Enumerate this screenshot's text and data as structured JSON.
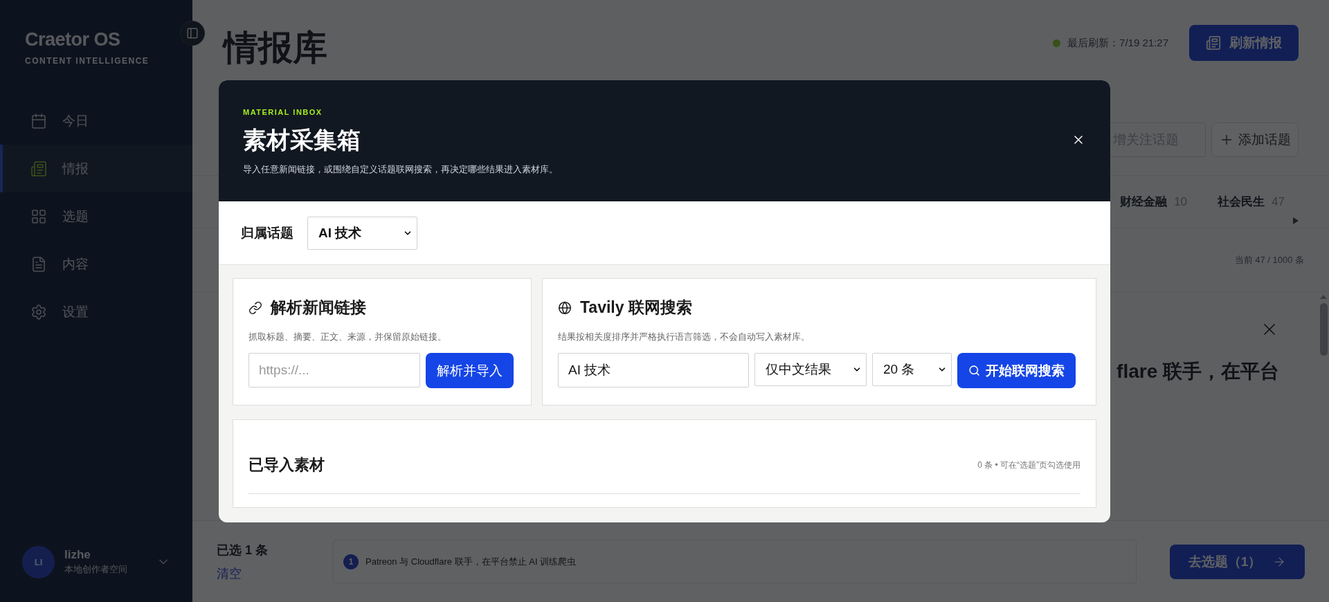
{
  "sidebar": {
    "brand": "Craetor OS",
    "brand_sub": "CONTENT INTELLIGENCE",
    "items": [
      {
        "label": "今日",
        "kind": "calendar",
        "selected": false
      },
      {
        "label": "情报",
        "kind": "news",
        "selected": true
      },
      {
        "label": "选题",
        "kind": "grid",
        "selected": false
      },
      {
        "label": "内容",
        "kind": "doc",
        "selected": false
      },
      {
        "label": "设置",
        "kind": "gear",
        "selected": false
      }
    ],
    "user": {
      "initials": "LI",
      "name": "lizhe",
      "workspace": "本地创作者空间"
    }
  },
  "header": {
    "title": "情报库",
    "refresh_label": "最后刷新：7/19 21:27",
    "refresh_button": "刷新情报"
  },
  "toolbar": {
    "topic_placeholder": "增关注话题",
    "add_button": "添加话题"
  },
  "topic_tabs": [
    {
      "label": "财经金融",
      "count": "10"
    },
    {
      "label": "社会民生",
      "count": "47"
    }
  ],
  "list_info": "当前 47 / 1000 条",
  "article": {
    "headline": "flare 联手，在平台"
  },
  "modal": {
    "eyebrow": "MATERIAL INBOX",
    "title": "素材采集箱",
    "description": "导入任意新闻链接，或围绕自定义话题联网搜索，再决定哪些结果进入素材库。",
    "topic_label": "归属话题",
    "topic_value": "AI 技术",
    "link_card": {
      "title": "解析新闻链接",
      "hint": "抓取标题、摘要、正文、来源，并保留原始链接。",
      "placeholder": "https://...",
      "button": "解析并导入"
    },
    "search_card": {
      "title": "Tavily 联网搜索",
      "hint": "结果按相关度排序并严格执行语言筛选，不会自动写入素材库。",
      "query": "AI 技术",
      "language": "仅中文结果",
      "count": "20 条",
      "button": "开始联网搜索"
    },
    "imported": {
      "title": "已导入素材",
      "meta": "0 条 • 可在“选题”页勾选使用"
    }
  },
  "selection_bar": {
    "count_label": "已选 1 条",
    "clear": "清空",
    "chips": [
      {
        "index": "1",
        "title": "Patreon 与 Cloudflare 联手，在平台禁止 AI 训练爬虫"
      }
    ],
    "go_button": "去选题（1）"
  }
}
